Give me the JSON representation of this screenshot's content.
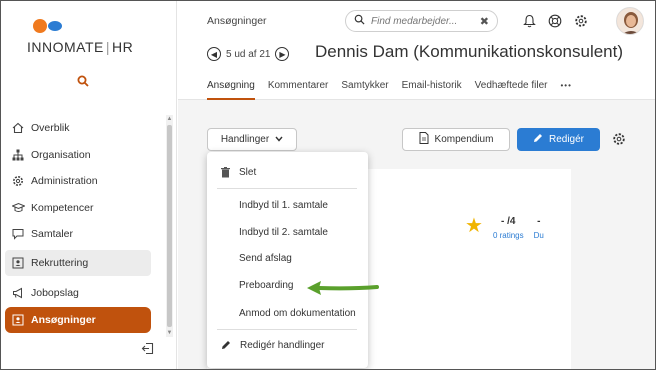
{
  "app": {
    "logo_name": "INNOMATE",
    "logo_suffix": "HR",
    "logo_divider": "|"
  },
  "sidebar": {
    "items": [
      {
        "label": "Overblik",
        "icon": "home-icon"
      },
      {
        "label": "Organisation",
        "icon": "org-chart-icon"
      },
      {
        "label": "Administration",
        "icon": "gear-icon"
      },
      {
        "label": "Kompetencer",
        "icon": "graduation-cap-icon"
      },
      {
        "label": "Samtaler",
        "icon": "chat-icon"
      },
      {
        "label": "Rekruttering",
        "icon": "id-card-icon"
      },
      {
        "label": "Jobopslag",
        "icon": "megaphone-icon"
      },
      {
        "label": "Ansøgninger",
        "icon": "id-card-icon"
      }
    ]
  },
  "header": {
    "breadcrumb": "Ansøgninger",
    "search_placeholder": "Find medarbejder...",
    "pager_text": "5 ud af 21",
    "person_title": "Dennis Dam (Kommunikationskonsulent)",
    "tabs": [
      "Ansøgning",
      "Kommentarer",
      "Samtykker",
      "Email-historik",
      "Vedhæftede filer"
    ],
    "more": "•••"
  },
  "toolbar": {
    "actions_label": "Handlinger",
    "compendium_label": "Kompendium",
    "edit_label": "Redigér"
  },
  "stats": {
    "rating_value": "- /4",
    "rating_label": "0 ratings",
    "du_value": "-",
    "du_label": "Du"
  },
  "dropdown": {
    "items": [
      "Slet",
      "Indbyd til 1. samtale",
      "Indbyd til 2. samtale",
      "Send afslag",
      "Preboarding",
      "Anmod om dokumentation",
      "Redigér handlinger"
    ]
  },
  "colors": {
    "accent": "#c0520d",
    "primary": "#2b7cd3",
    "arrow": "#5aa02c",
    "star": "#f0b400"
  }
}
